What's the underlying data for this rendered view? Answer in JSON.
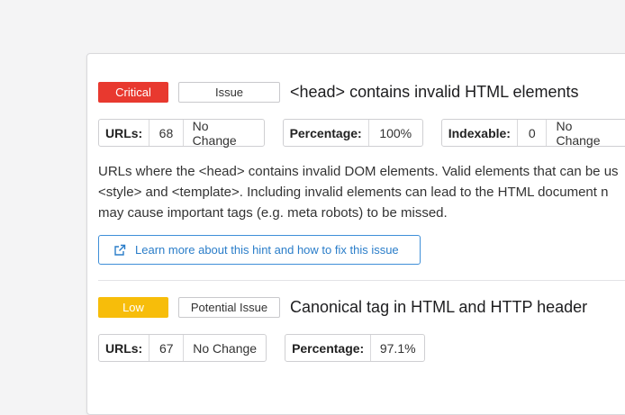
{
  "issues": [
    {
      "severity": "Critical",
      "type": "Issue",
      "title": "<head> contains invalid HTML elements",
      "stats": [
        {
          "label": "URLs:",
          "value": "68",
          "change": "No Change"
        },
        {
          "label": "Percentage:",
          "value": "100%"
        },
        {
          "label": "Indexable:",
          "value": "0",
          "change": "No Change"
        }
      ],
      "description_lines": [
        "URLs where the <head> contains invalid DOM elements. Valid elements that can be us",
        "<style> and <template>. Including invalid elements can lead to the HTML document n",
        "may cause important tags (e.g. meta robots) to be missed."
      ],
      "learn_more": "Learn more about this hint and how to fix this issue"
    },
    {
      "severity": "Low",
      "type": "Potential Issue",
      "title": "Canonical tag in HTML and HTTP header",
      "stats": [
        {
          "label": "URLs:",
          "value": "67",
          "change": "No Change"
        },
        {
          "label": "Percentage:",
          "value": "97.1%"
        }
      ]
    }
  ],
  "colors": {
    "critical": "#e8392f",
    "low": "#f7bd0a",
    "link": "#2a7dc9"
  },
  "icons": {
    "learn_more": "external-link-icon"
  }
}
